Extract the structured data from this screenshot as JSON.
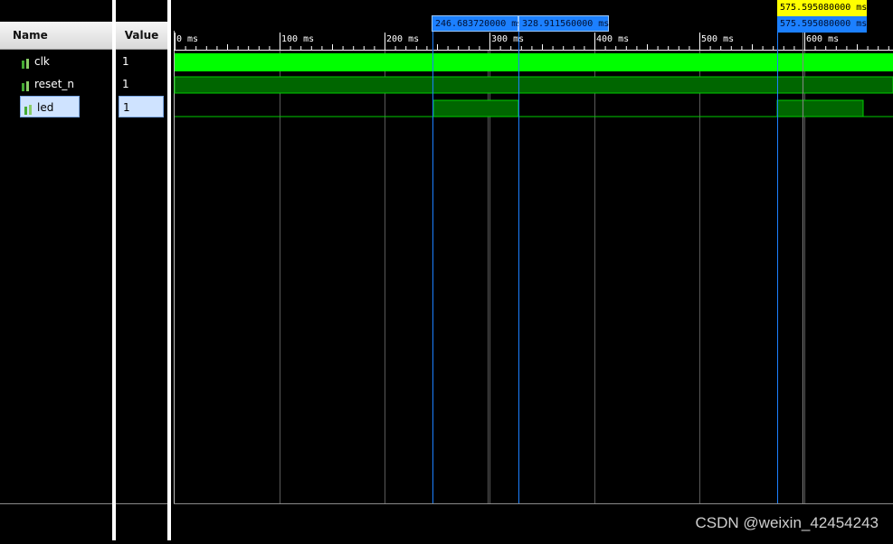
{
  "columns": {
    "name": "Name",
    "value": "Value"
  },
  "signals": [
    {
      "name": "clk",
      "value": "1",
      "selected": false
    },
    {
      "name": "reset_n",
      "value": "1",
      "selected": false
    },
    {
      "name": "led",
      "value": "1",
      "selected": true
    }
  ],
  "ruler": {
    "unit": "ms",
    "ticks": [
      "0 ms",
      "100 ms",
      "200 ms",
      "300 ms",
      "400 ms",
      "500 ms",
      "600 ms"
    ]
  },
  "cursors": {
    "c1": "246.683720000 ms",
    "c2": "328.911560000 ms",
    "main_top": "575.595080000 ms",
    "main_bottom": "575.595080000 ms"
  },
  "colors": {
    "clk": "#00ff00",
    "bus": "#006600",
    "line": "#00cc00",
    "cursor_blue": "#1c80ff",
    "cursor_yellow": "#ffff00",
    "grid": "#555555"
  },
  "watermark": "CSDN @weixin_42454243"
}
